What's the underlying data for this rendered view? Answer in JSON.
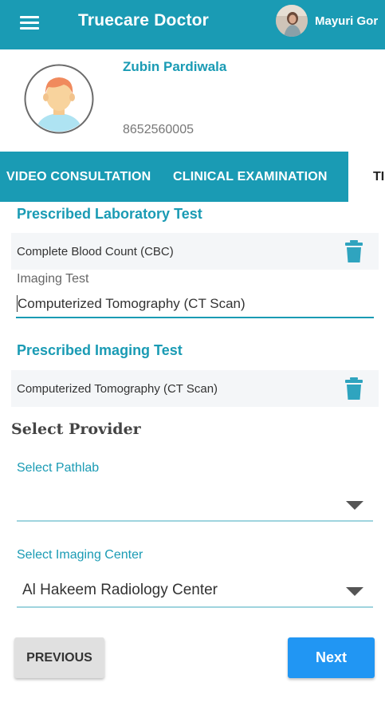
{
  "app": {
    "title": "Truecare Doctor",
    "user_name": "Mayuri Gor"
  },
  "patient": {
    "name": "Zubin Pardiwala",
    "phone": "8652560005"
  },
  "tabs": [
    {
      "label": "VIDEO CONSULTATION"
    },
    {
      "label": "CLINICAL EXAMINATION"
    },
    {
      "label": "TI",
      "active": true
    }
  ],
  "lab": {
    "heading": "Prescribed Laboratory Test",
    "items": [
      {
        "name": "Complete Blood Count (CBC)"
      }
    ]
  },
  "imaging_input": {
    "label": "Imaging Test",
    "value": "Computerized Tomography (CT Scan)"
  },
  "imaging": {
    "heading": "Prescribed Imaging Test",
    "items": [
      {
        "name": "Computerized Tomography (CT Scan)"
      }
    ]
  },
  "provider": {
    "heading": "Select Provider",
    "pathlab": {
      "label": "Select Pathlab",
      "value": ""
    },
    "imaging_center": {
      "label": "Select Imaging Center",
      "value": "Al Hakeem Radiology Center"
    }
  },
  "buttons": {
    "previous": "PREVIOUS",
    "next": "Next"
  },
  "icons": {
    "menu": "hamburger-menu-icon",
    "delete": "trash-icon",
    "dropdown": "caret-down-icon"
  },
  "colors": {
    "primary": "#1a9bb4",
    "accent_button": "#2196f3",
    "row_bg": "#f4f6f8"
  }
}
